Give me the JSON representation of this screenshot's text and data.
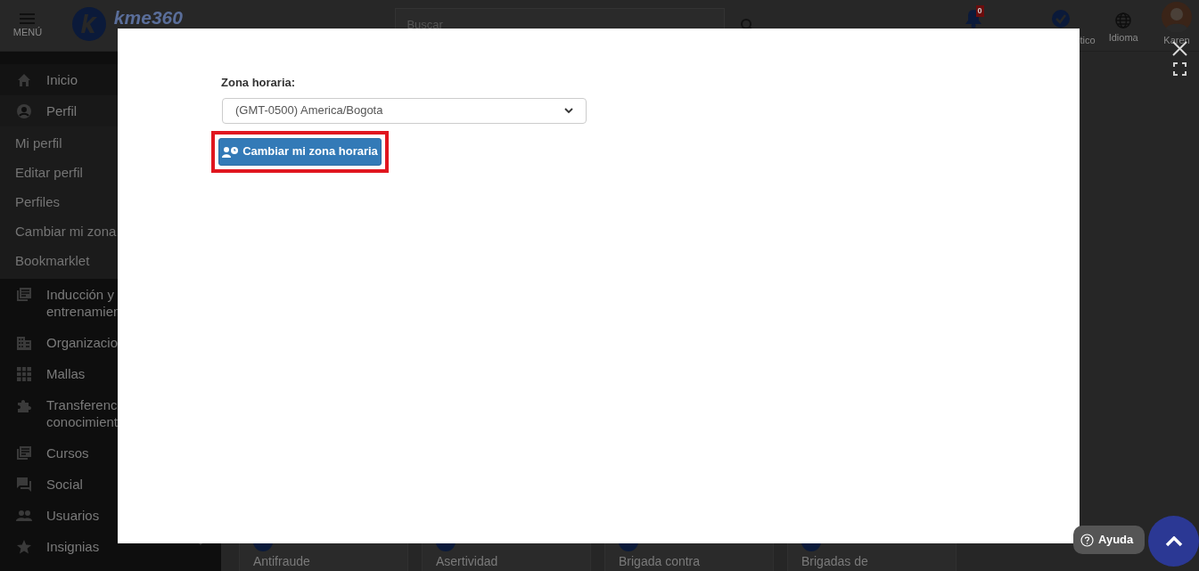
{
  "header": {
    "menu_label": "MENÚ",
    "logo_text": "kme360",
    "search_placeholder": "Buscar",
    "notification_count": "0",
    "items": [
      {
        "label": "tico"
      },
      {
        "label": "Idioma"
      },
      {
        "label": "Karen"
      }
    ]
  },
  "sidebar": {
    "items": [
      {
        "label": "Inicio"
      },
      {
        "label": "Perfil",
        "expanded": true,
        "children": [
          {
            "label": "Mi perfil"
          },
          {
            "label": "Editar perfil"
          },
          {
            "label": "Perfiles"
          },
          {
            "label": "Cambiar mi zona"
          },
          {
            "label": "Bookmarklet"
          }
        ]
      },
      {
        "label": "Inducción y entrenamien"
      },
      {
        "label": "Organizacio"
      },
      {
        "label": "Mallas"
      },
      {
        "label": "Transferenc conocimient"
      },
      {
        "label": "Cursos"
      },
      {
        "label": "Social"
      },
      {
        "label": "Usuarios"
      },
      {
        "label": "Insignias"
      }
    ]
  },
  "cards": [
    {
      "title": "Antifraude"
    },
    {
      "title": "Asertividad"
    },
    {
      "title": "Brigada contra"
    },
    {
      "title": "Brigadas de"
    }
  ],
  "modal": {
    "field_label": "Zona horaria:",
    "select_value": "(GMT-0500) America/Bogota",
    "button_label": "Cambiar mi zona horaria",
    "highlighted": true
  },
  "help_button": {
    "label": "Ayuda"
  }
}
